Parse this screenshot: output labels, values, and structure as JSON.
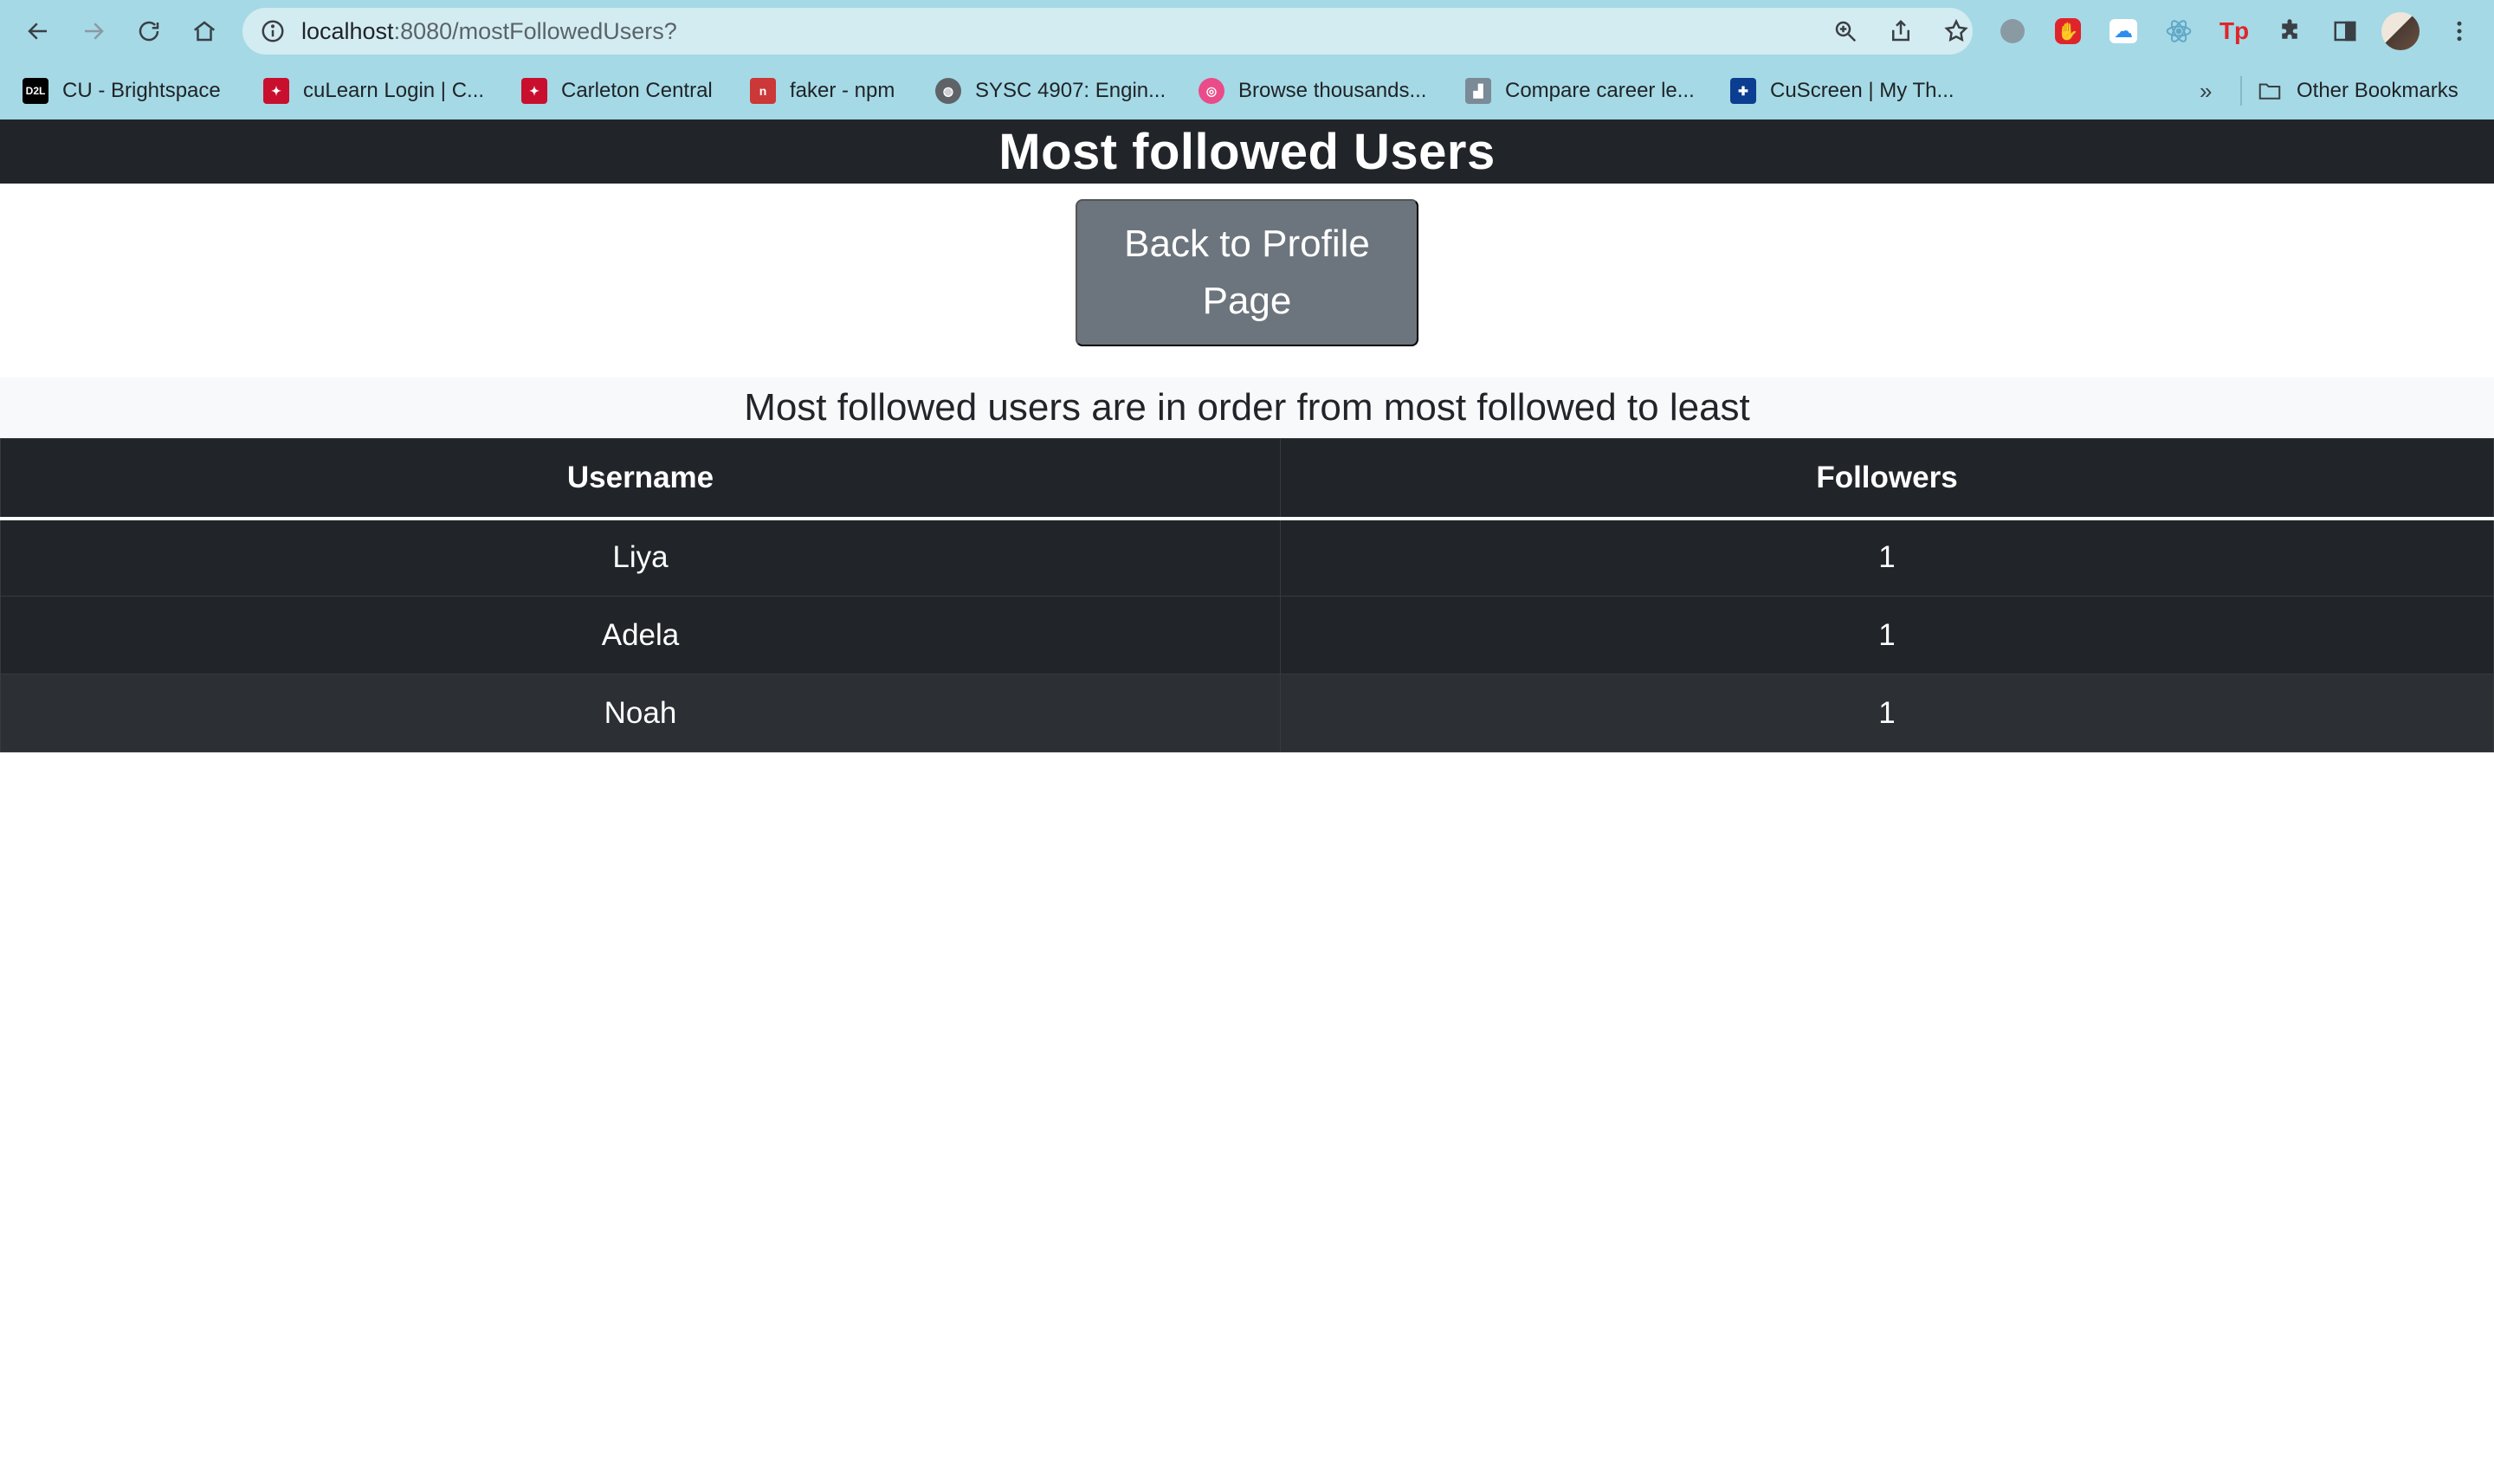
{
  "browser": {
    "url_host": "localhost",
    "url_path": ":8080/mostFollowedUsers?",
    "bookmarks": [
      {
        "label": "CU - Brightspace",
        "icon": "d2l-icon",
        "color": "#000000"
      },
      {
        "label": "cuLearn Login | C...",
        "icon": "carleton-icon",
        "color": "#c8102e"
      },
      {
        "label": "Carleton Central",
        "icon": "carleton-icon",
        "color": "#c8102e"
      },
      {
        "label": "faker - npm",
        "icon": "npm-icon",
        "color": "#cb3837"
      },
      {
        "label": "SYSC 4907: Engin...",
        "icon": "globe-icon",
        "color": "#5f6368"
      },
      {
        "label": "Browse thousands...",
        "icon": "dribbble-icon",
        "color": "#ea4c89"
      },
      {
        "label": "Compare career le...",
        "icon": "chart-icon",
        "color": "#7a8a96"
      },
      {
        "label": "CuScreen | My Th...",
        "icon": "cuscreen-icon",
        "color": "#0b3d91"
      }
    ],
    "bookmarks_more": "»",
    "other_bookmarks": "Other Bookmarks"
  },
  "page": {
    "title": "Most followed Users",
    "back_button": "Back to Profile Page",
    "caption": "Most followed users are in order from most followed to least"
  },
  "table": {
    "headers": [
      "Username",
      "Followers"
    ],
    "rows": [
      [
        "Liya",
        "1"
      ],
      [
        "Adela",
        "1"
      ],
      [
        "Noah",
        "1"
      ]
    ]
  },
  "colors": {
    "toolbar": "#a5d9e6",
    "header_bg": "#212529",
    "button_bg": "#6c757d"
  }
}
